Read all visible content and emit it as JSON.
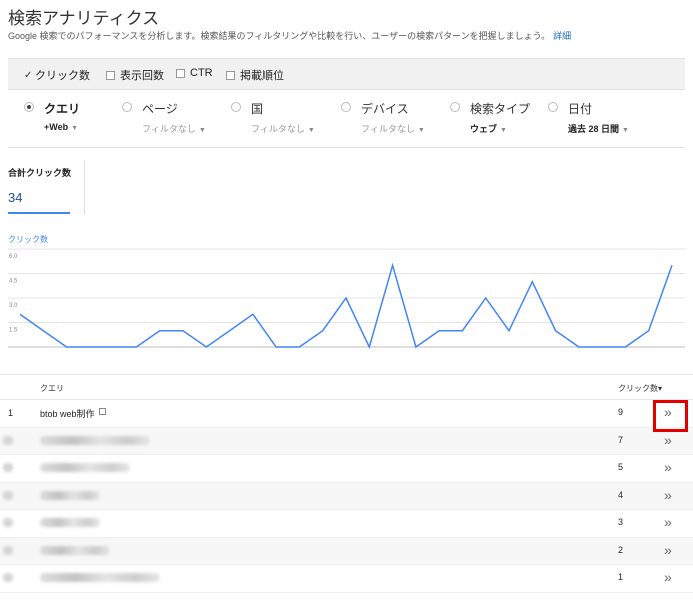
{
  "header": {
    "title": "検索アナリティクス",
    "description": "Google 検索でのパフォーマンスを分析します。検索結果のフィルタリングや比較を行い、ユーザーの検索パターンを把握しましょう。",
    "details_link": "詳細"
  },
  "metrics": [
    {
      "label": "クリック数",
      "checked": true
    },
    {
      "label": "表示回数",
      "checked": false
    },
    {
      "label": "CTR",
      "checked": false
    },
    {
      "label": "掲載順位",
      "checked": false
    }
  ],
  "filters": [
    {
      "label": "クエリ",
      "sub": "+Web",
      "selected": true
    },
    {
      "label": "ページ",
      "sub": "フィルタなし",
      "selected": false
    },
    {
      "label": "国",
      "sub": "フィルタなし",
      "selected": false
    },
    {
      "label": "デバイス",
      "sub": "フィルタなし",
      "selected": false
    },
    {
      "label": "検索タイプ",
      "sub": "ウェブ",
      "selected": false
    },
    {
      "label": "日付",
      "sub": "過去 28 日間",
      "selected": false
    }
  ],
  "total": {
    "label": "合計クリック数",
    "value": "34"
  },
  "chart_data": {
    "type": "line",
    "ylabel": "クリック数",
    "ylim": [
      0,
      6
    ],
    "yticks": [
      "6.0",
      "4.5",
      "3.0",
      "1.5"
    ],
    "grid": true,
    "color": "#4285f4",
    "values": [
      2,
      1,
      0,
      0,
      0,
      0,
      1,
      1,
      0,
      1,
      2,
      0,
      0,
      1,
      3,
      0,
      5,
      0,
      1,
      1,
      3,
      1,
      4,
      1,
      0,
      0,
      0,
      1,
      5
    ]
  },
  "table": {
    "col_query": "クエリ",
    "col_clicks": "クリック数",
    "sort_indicator": "▾",
    "arrow_glyph": "»",
    "rows": [
      {
        "index": "1",
        "query": "btob web制作",
        "clicks": "9"
      },
      {
        "index": "",
        "query": "",
        "clicks": "7"
      },
      {
        "index": "",
        "query": "",
        "clicks": "5"
      },
      {
        "index": "",
        "query": "",
        "clicks": "4"
      },
      {
        "index": "",
        "query": "",
        "clicks": "3"
      },
      {
        "index": "",
        "query": "",
        "clicks": "2"
      },
      {
        "index": "",
        "query": "",
        "clicks": "1"
      }
    ]
  }
}
